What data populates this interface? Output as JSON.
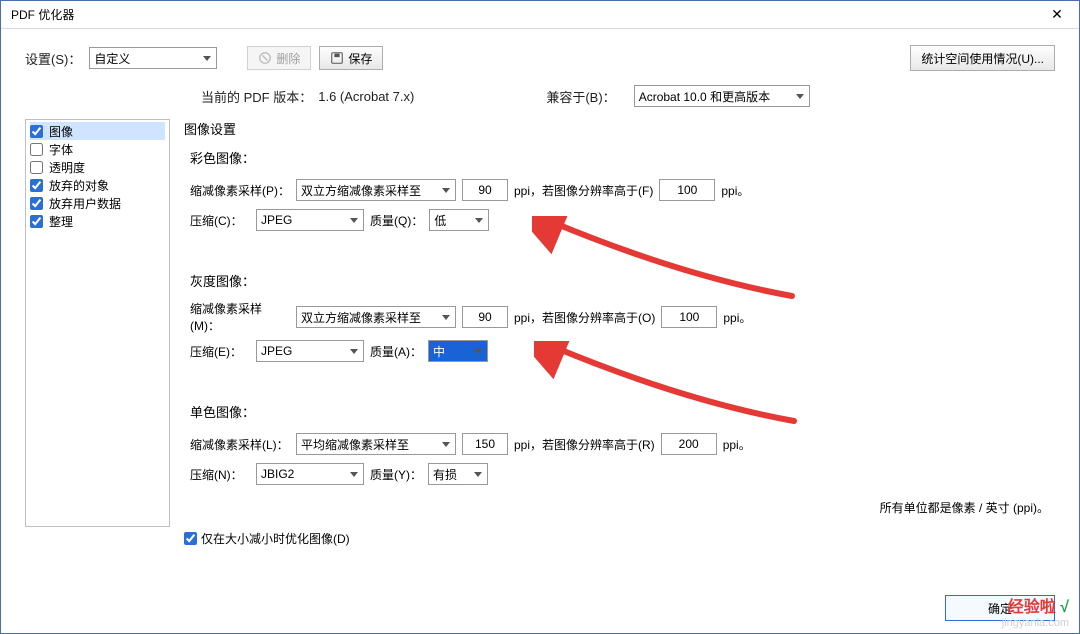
{
  "window": {
    "title": "PDF 优化器"
  },
  "top": {
    "settings_label": "设置(S)：",
    "settings_value": "自定义",
    "delete_label": "删除",
    "save_label": "保存",
    "space_usage_label": "统计空间使用情况(U)..."
  },
  "version": {
    "current_label": "当前的 PDF 版本：",
    "current_value": "1.6 (Acrobat 7.x)",
    "compat_label": "兼容于(B)：",
    "compat_value": "Acrobat 10.0 和更高版本"
  },
  "sidebar": {
    "items": [
      {
        "label": "图像",
        "checked": true
      },
      {
        "label": "字体",
        "checked": false
      },
      {
        "label": "透明度",
        "checked": false
      },
      {
        "label": "放弃的对象",
        "checked": true
      },
      {
        "label": "放弃用户数据",
        "checked": true
      },
      {
        "label": "整理",
        "checked": true
      }
    ]
  },
  "group_title": "图像设置",
  "color": {
    "title": "彩色图像：",
    "downsample_label": "缩减像素采样(P)：",
    "downsample_value": "双立方缩减像素采样至",
    "ppi1": "90",
    "ppi_text": "ppi，若图像分辨率高于(F)",
    "ppi2": "100",
    "ppi_suffix": "ppi。",
    "compress_label": "压缩(C)：",
    "compress_value": "JPEG",
    "quality_label": "质量(Q)：",
    "quality_value": "低"
  },
  "gray": {
    "title": "灰度图像：",
    "downsample_label": "缩减像素采样(M)：",
    "downsample_value": "双立方缩减像素采样至",
    "ppi1": "90",
    "ppi_text": "ppi，若图像分辨率高于(O)",
    "ppi2": "100",
    "ppi_suffix": "ppi。",
    "compress_label": "压缩(E)：",
    "compress_value": "JPEG",
    "quality_label": "质量(A)：",
    "quality_value": "中"
  },
  "mono": {
    "title": "单色图像：",
    "downsample_label": "缩减像素采样(L)：",
    "downsample_value": "平均缩减像素采样至",
    "ppi1": "150",
    "ppi_text": "ppi，若图像分辨率高于(R)",
    "ppi2": "200",
    "ppi_suffix": "ppi。",
    "compress_label": "压缩(N)：",
    "compress_value": "JBIG2",
    "quality_label": "质量(Y)：",
    "quality_value": "有损"
  },
  "footnote": "所有单位都是像素 / 英寸 (ppi)。",
  "opt_checkbox": "仅在大小减小时优化图像(D)",
  "opt_checked": true,
  "ok": "确定",
  "watermark": {
    "logo1": "经验啦",
    "chk": "√",
    "url": "jingyanla.com"
  }
}
